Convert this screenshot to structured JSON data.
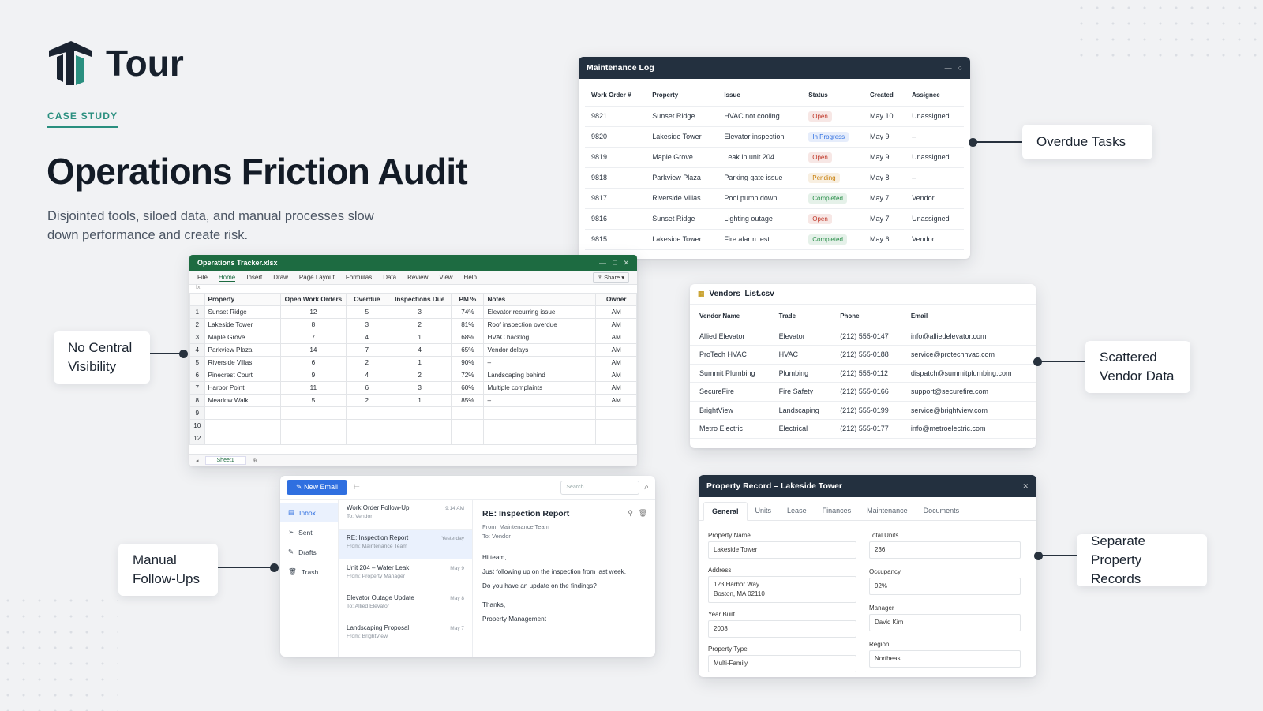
{
  "brand": {
    "name": "Tour"
  },
  "hero": {
    "eyebrow": "CASE STUDY",
    "title": "Operations Friction Audit",
    "subtitle": "Disjointed tools, siloed data, and manual processes slow down performance and create risk."
  },
  "callouts": {
    "overdue": "Overdue Tasks",
    "visibility": "No Central Visibility",
    "vendor": "Scattered Vendor Data",
    "followups": "Manual Follow-Ups",
    "records": "Separate Property Records"
  },
  "maintenance_log": {
    "title": "Maintenance Log",
    "columns": [
      "Work Order #",
      "Property",
      "Issue",
      "Status",
      "Created",
      "Assignee"
    ],
    "rows": [
      [
        "9821",
        "Sunset Ridge",
        "HVAC not cooling",
        "Open",
        "May 10",
        "Unassigned"
      ],
      [
        "9820",
        "Lakeside Tower",
        "Elevator inspection",
        "In Progress",
        "May 9",
        "–"
      ],
      [
        "9819",
        "Maple Grove",
        "Leak in unit 204",
        "Open",
        "May 9",
        "Unassigned"
      ],
      [
        "9818",
        "Parkview Plaza",
        "Parking gate issue",
        "Pending",
        "May 8",
        "–"
      ],
      [
        "9817",
        "Riverside Villas",
        "Pool pump down",
        "Completed",
        "May 7",
        "Vendor"
      ],
      [
        "9816",
        "Sunset Ridge",
        "Lighting outage",
        "Open",
        "May 7",
        "Unassigned"
      ],
      [
        "9815",
        "Lakeside Tower",
        "Fire alarm test",
        "Completed",
        "May 6",
        "Vendor"
      ]
    ],
    "status_colors": {
      "Open": "#c0392b",
      "In Progress": "#2f6fe0",
      "Pending": "#c87f0a",
      "Completed": "#2a8f4a"
    }
  },
  "spreadsheet": {
    "title": "Operations Tracker.xlsx",
    "menu": [
      "File",
      "Home",
      "Insert",
      "Draw",
      "Page Layout",
      "Formulas",
      "Data",
      "Review",
      "View",
      "Help"
    ],
    "share": "Share",
    "columns": [
      "Property",
      "Open Work Orders",
      "Overdue",
      "Inspections Due",
      "PM %",
      "Notes",
      "Owner"
    ],
    "rows": [
      [
        "Sunset Ridge",
        "12",
        "5",
        "3",
        "74%",
        "Elevator recurring issue",
        "AM"
      ],
      [
        "Lakeside Tower",
        "8",
        "3",
        "2",
        "81%",
        "Roof inspection overdue",
        "AM"
      ],
      [
        "Maple Grove",
        "7",
        "4",
        "1",
        "68%",
        "HVAC backlog",
        "AM"
      ],
      [
        "Parkview Plaza",
        "14",
        "7",
        "4",
        "65%",
        "Vendor delays",
        "AM"
      ],
      [
        "Riverside Villas",
        "6",
        "2",
        "1",
        "90%",
        "–",
        "AM"
      ],
      [
        "Pinecrest Court",
        "9",
        "4",
        "2",
        "72%",
        "Landscaping behind",
        "AM"
      ],
      [
        "Harbor Point",
        "11",
        "6",
        "3",
        "60%",
        "Multiple complaints",
        "AM"
      ],
      [
        "Meadow Walk",
        "5",
        "2",
        "1",
        "85%",
        "–",
        "AM"
      ]
    ],
    "row_numbers": [
      "1",
      "2",
      "3",
      "4",
      "5",
      "6",
      "7",
      "8",
      "9",
      "10",
      "12"
    ],
    "sheet": "Sheet1"
  },
  "vendors": {
    "title": "Vendors_List.csv",
    "columns": [
      "Vendor Name",
      "Trade",
      "Phone",
      "Email"
    ],
    "rows": [
      [
        "Allied Elevator",
        "Elevator",
        "(212) 555-0147",
        "info@alliedelevator.com"
      ],
      [
        "ProTech HVAC",
        "HVAC",
        "(212) 555-0188",
        "service@protechhvac.com"
      ],
      [
        "Summit Plumbing",
        "Plumbing",
        "(212) 555-0112",
        "dispatch@summitplumbing.com"
      ],
      [
        "SecureFire",
        "Fire Safety",
        "(212) 555-0166",
        "support@securefire.com"
      ],
      [
        "BrightView",
        "Landscaping",
        "(212) 555-0199",
        "service@brightview.com"
      ],
      [
        "Metro Electric",
        "Electrical",
        "(212) 555-0177",
        "info@metroelectric.com"
      ]
    ]
  },
  "email": {
    "new_button": "New Email",
    "search_placeholder": "Search",
    "folders": [
      "Inbox",
      "Sent",
      "Drafts",
      "Trash"
    ],
    "messages": [
      {
        "subject": "Work Order Follow-Up",
        "from": "To: Vendor",
        "date": "9:14 AM"
      },
      {
        "subject": "RE: Inspection Report",
        "from": "From: Maintenance Team",
        "date": "Yesterday"
      },
      {
        "subject": "Unit 204 – Water Leak",
        "from": "From: Property Manager",
        "date": "May 9"
      },
      {
        "subject": "Elevator Outage Update",
        "from": "To: Allied Elevator",
        "date": "May 8"
      },
      {
        "subject": "Landscaping Proposal",
        "from": "From: BrightView",
        "date": "May 7"
      }
    ],
    "reading": {
      "subject": "RE: Inspection Report",
      "from": "From: Maintenance Team",
      "to": "To: Vendor",
      "body": [
        "Hi team,",
        "Just following up on the inspection from last week.",
        "Do you have an update on the findings?",
        "Thanks,",
        "Property Management"
      ]
    }
  },
  "property": {
    "title": "Property Record – Lakeside Tower",
    "tabs": [
      "General",
      "Units",
      "Lease",
      "Finances",
      "Maintenance",
      "Documents"
    ],
    "left": [
      {
        "label": "Property Name",
        "value": "Lakeside Tower"
      },
      {
        "label": "Address",
        "value": "123 Harbor Way",
        "value2": "Boston, MA 02110"
      },
      {
        "label": "Year Built",
        "value": "2008"
      },
      {
        "label": "Property Type",
        "value": "Multi-Family"
      }
    ],
    "right": [
      {
        "label": "Total Units",
        "value": "236"
      },
      {
        "label": "Occupancy",
        "value": "92%"
      },
      {
        "label": "Manager",
        "value": "David Kim"
      },
      {
        "label": "Region",
        "value": "Northeast"
      }
    ]
  }
}
